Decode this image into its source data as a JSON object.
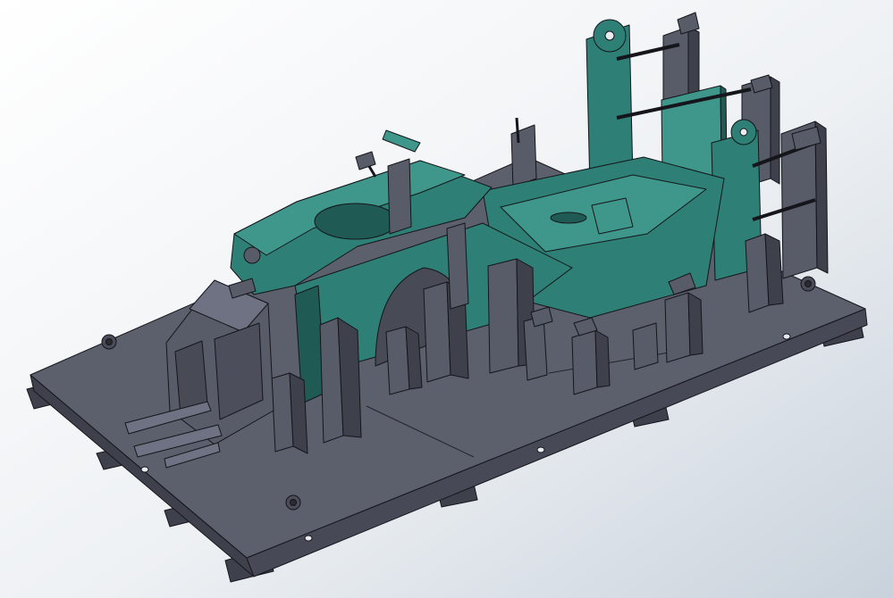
{
  "viewport": {
    "background_light": "#FFFFFF",
    "background_dark": "#C9D2DC"
  },
  "model": {
    "steel_color": "#585B68",
    "steel_light": "#6E7282",
    "steel_dark": "#3E404B",
    "part_color": "#2E7F76",
    "part_light": "#3F978C",
    "part_dark": "#205A54",
    "edge_color": "#15161B",
    "hole_color": "#E9ECEF"
  }
}
